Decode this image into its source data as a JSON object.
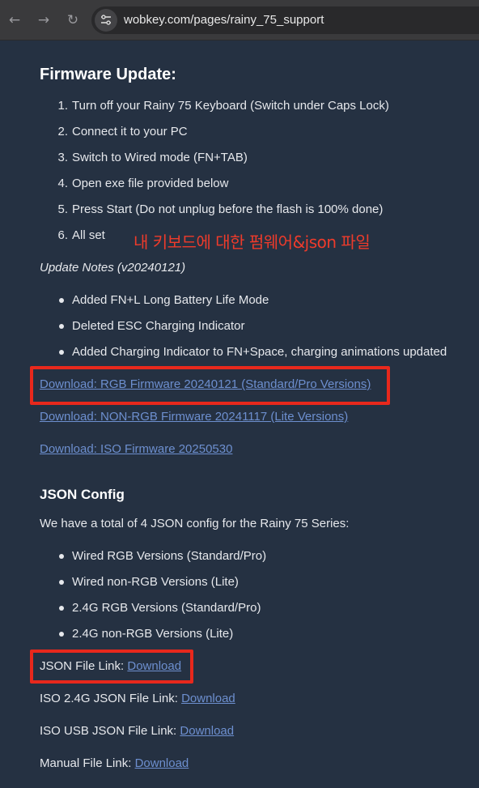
{
  "browser": {
    "url": "wobkey.com/pages/rainy_75_support",
    "back_icon": "arrow-left-icon",
    "forward_icon": "arrow-right-icon",
    "reload_icon": "reload-icon",
    "site_info_icon": "site-settings-icon"
  },
  "firmware": {
    "heading": "Firmware Update:",
    "steps": [
      {
        "num": "1.",
        "text": "Turn off your Rainy 75 Keyboard (Switch under Caps Lock)"
      },
      {
        "num": "2.",
        "text": "Connect it to your PC"
      },
      {
        "num": "3.",
        "text": "Switch to Wired mode (FN+TAB)"
      },
      {
        "num": "4.",
        "text": "Open exe file provided below"
      },
      {
        "num": "5.",
        "text": "Press Start (Do not unplug before the flash is 100% done)"
      },
      {
        "num": "6.",
        "text": "All set"
      }
    ],
    "update_notes_title": "Update Notes (v20240121)",
    "notes": [
      "Added FN+L Long Battery Life Mode",
      "Deleted ESC Charging Indicator",
      "Added Charging Indicator to FN+Space, charging animations updated"
    ],
    "downloads": [
      "Download: RGB Firmware 20240121 (Standard/Pro Versions)",
      "Download: NON-RGB Firmware 20241117 (Lite Versions)",
      "Download: ISO Firmware 20250530"
    ]
  },
  "annotation": {
    "text": "내 키보드에 대한 펌웨어&json 파일",
    "color": "#e8281c"
  },
  "json_config": {
    "heading": "JSON Config",
    "intro": "We have a total of 4 JSON config for the Rainy 75 Series:",
    "items": [
      "Wired RGB Versions (Standard/Pro)",
      "Wired non-RGB Versions (Lite)",
      "2.4G RGB Versions (Standard/Pro)",
      "2.4G non-RGB Versions (Lite)"
    ],
    "file_links": [
      {
        "label": "JSON File Link: ",
        "link": "Download"
      },
      {
        "label": "ISO 2.4G JSON File Link: ",
        "link": "Download"
      },
      {
        "label": "ISO USB JSON File Link: ",
        "link": "Download"
      },
      {
        "label": "Manual File Link: ",
        "link": "Download"
      }
    ]
  },
  "colors": {
    "background": "#253142",
    "link": "#6d8fcf",
    "highlight": "#e8281c"
  }
}
